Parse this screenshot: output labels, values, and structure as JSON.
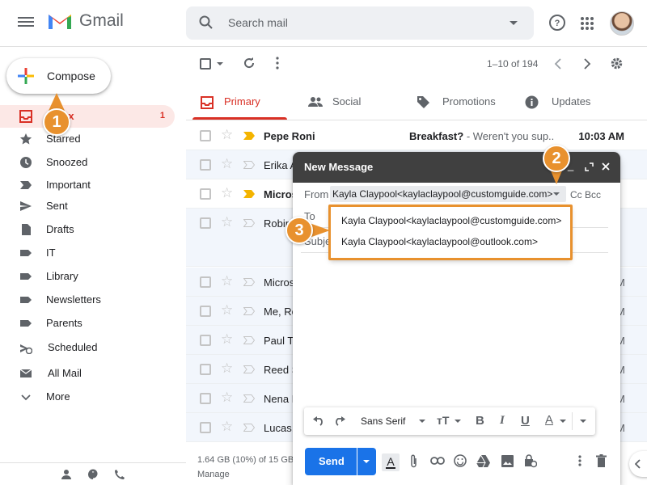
{
  "app": {
    "title": "Gmail"
  },
  "search": {
    "placeholder": "Search mail"
  },
  "compose_button": {
    "label": "Compose"
  },
  "sidebar": {
    "items": [
      {
        "label": "Inbox",
        "count": "1",
        "icon": "inbox-icon"
      },
      {
        "label": "Starred",
        "icon": "star-icon"
      },
      {
        "label": "Snoozed",
        "icon": "clock-icon"
      },
      {
        "label": "Important",
        "icon": "important-icon"
      },
      {
        "label": "Sent",
        "icon": "send-icon"
      },
      {
        "label": "Drafts",
        "icon": "draft-icon"
      },
      {
        "label": "IT",
        "icon": "label-icon"
      },
      {
        "label": "Library",
        "icon": "label-icon"
      },
      {
        "label": "Newsletters",
        "icon": "label-icon"
      },
      {
        "label": "Parents",
        "icon": "label-icon"
      },
      {
        "label": "Scheduled",
        "icon": "scheduled-icon"
      },
      {
        "label": "All Mail",
        "icon": "mail-icon"
      },
      {
        "label": "More",
        "icon": "chevron-down-icon"
      }
    ]
  },
  "toolbar": {
    "pager": "1–10 of 194"
  },
  "tabs": [
    {
      "label": "Primary",
      "icon": "inbox-icon"
    },
    {
      "label": "Social",
      "icon": "people-icon"
    },
    {
      "label": "Promotions",
      "icon": "tag-icon"
    },
    {
      "label": "Updates",
      "icon": "info-icon"
    }
  ],
  "emails": [
    {
      "sender": "Pepe Roni",
      "subject": "Breakfast?",
      "snippet": " - Weren't you sup...",
      "time": "10:03 AM",
      "unread": true
    },
    {
      "sender": "Erika A",
      "time": "",
      "unread": false
    },
    {
      "sender": "Micros",
      "time": "",
      "unread": true
    },
    {
      "sender": "Robin",
      "time": "",
      "unread": false
    },
    {
      "sender": "Micros",
      "time": "M",
      "unread": false
    },
    {
      "sender": "Me, Re",
      "time": "M",
      "unread": false
    },
    {
      "sender": "Paul T",
      "time": "M",
      "unread": false
    },
    {
      "sender": "Reed S",
      "time": "M",
      "unread": false
    },
    {
      "sender": "Nena M",
      "time": "M",
      "unread": false
    },
    {
      "sender": "Lucas,",
      "time": "M",
      "unread": false
    }
  ],
  "storage": {
    "text": "1.64 GB (10%) of 15 GB",
    "manage": "Manage"
  },
  "compose_window": {
    "title": "New Message",
    "from_label": "From",
    "from_value": "Kayla Claypool<kaylaclaypool@customguide.com>",
    "cc_bcc": "Cc Bcc",
    "to_label": "To",
    "subject_label": "Subject",
    "from_options": [
      "Kayla Claypool<kaylaclaypool@customguide.com>",
      "Kayla Claypool<kaylaclaypool@outlook.com>"
    ],
    "font": "Sans Serif",
    "send_label": "Send"
  },
  "callouts": [
    "1",
    "2",
    "3"
  ],
  "colors": {
    "accent": "#d93025",
    "send": "#1a73e8",
    "callout": "#e8912e",
    "compose_header": "#404040"
  }
}
